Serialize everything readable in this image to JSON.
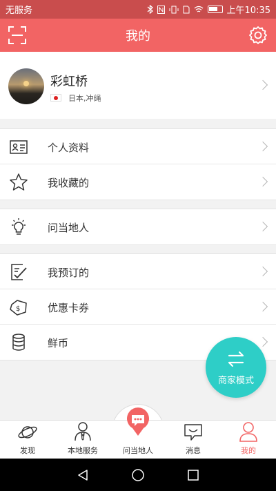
{
  "status_bar": {
    "carrier": "无服务",
    "time": "上午10:35"
  },
  "header": {
    "title": "我的"
  },
  "profile": {
    "name": "彩虹桥",
    "location": "日本,冲绳"
  },
  "menu_groups": [
    [
      {
        "label": "个人资料",
        "icon": "id-card-icon"
      },
      {
        "label": "我收藏的",
        "icon": "star-icon"
      }
    ],
    [
      {
        "label": "问当地人",
        "icon": "lightbulb-icon"
      }
    ],
    [
      {
        "label": "我预订的",
        "icon": "checklist-icon"
      },
      {
        "label": "优惠卡券",
        "icon": "coupon-icon"
      },
      {
        "label": "鲜币",
        "icon": "coins-icon"
      }
    ]
  ],
  "fab": {
    "label": "商家模式"
  },
  "tabs": [
    {
      "label": "发现",
      "icon": "planet-icon"
    },
    {
      "label": "本地服务",
      "icon": "person-icon"
    },
    {
      "label": "问当地人",
      "icon": "chat-pin-icon"
    },
    {
      "label": "消息",
      "icon": "message-icon"
    },
    {
      "label": "我的",
      "icon": "user-icon"
    }
  ],
  "colors": {
    "accent": "#f26464",
    "fab": "#2ecec7"
  }
}
